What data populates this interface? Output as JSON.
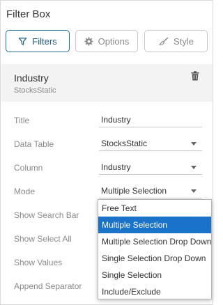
{
  "panel": {
    "title": "Filter Box"
  },
  "tabs": [
    {
      "label": "Filters",
      "icon": "filter-icon",
      "active": true
    },
    {
      "label": "Options",
      "icon": "gear-icon",
      "active": false
    },
    {
      "label": "Style",
      "icon": "brush-icon",
      "active": false
    }
  ],
  "section": {
    "title": "Industry",
    "subtitle": "StocksStatic",
    "action_icon": "trash-icon"
  },
  "fields": {
    "title": {
      "label": "Title",
      "value": "Industry"
    },
    "data_table": {
      "label": "Data Table",
      "value": "StocksStatic"
    },
    "column": {
      "label": "Column",
      "value": "Industry"
    },
    "mode": {
      "label": "Mode",
      "value": "Multiple Selection"
    },
    "show_search_bar": {
      "label": "Show Search Bar"
    },
    "show_select_all": {
      "label": "Show Select All"
    },
    "show_values": {
      "label": "Show Values"
    },
    "append_separator": {
      "label": "Append Separator"
    }
  },
  "mode_options": [
    "Free Text",
    "Multiple Selection",
    "Multiple Selection Drop Down",
    "Single Selection Drop Down",
    "Single Selection",
    "Include/Exclude"
  ],
  "mode_selected": "Multiple Selection",
  "colors": {
    "accent": "#1e6f8f",
    "selected_option": "#1a73c8",
    "section_bg": "#f3f3f3"
  }
}
